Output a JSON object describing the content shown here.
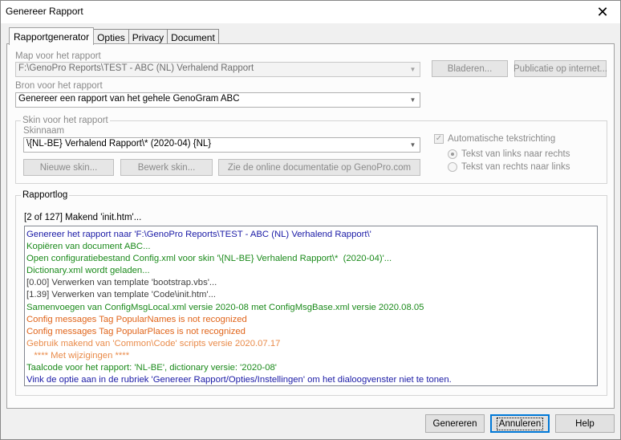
{
  "window": {
    "title": "Genereer Rapport",
    "close_symbol": "✕"
  },
  "tabs": [
    {
      "label": "Rapportgenerator",
      "active": true
    },
    {
      "label": "Opties",
      "active": false
    },
    {
      "label": "Privacy",
      "active": false
    },
    {
      "label": "Document",
      "active": false
    }
  ],
  "map": {
    "label": "Map voor het rapport",
    "value": "F:\\GenoPro Reports\\TEST - ABC (NL) Verhalend Rapport",
    "browse_label": "Bladeren...",
    "publish_label": "Publicatie op internet..."
  },
  "source": {
    "label": "Bron voor het rapport",
    "value": "Genereer een rapport van het gehele GenoGram ABC"
  },
  "skin": {
    "group_label": "Skin voor het rapport",
    "name_label": "Skinnaam",
    "value": "\\{NL-BE} Verhalend Rapport\\*  (2020-04)  {NL}",
    "new_label": "Nieuwe skin...",
    "edit_label": "Bewerk skin...",
    "docs_label": "Zie de online documentatie op GenoPro.com",
    "auto_direction_label": "Automatische tekstrichting",
    "auto_direction_checked": true,
    "ltr_label": "Tekst van links naar rechts",
    "rtl_label": "Tekst van rechts naar links",
    "ltr_selected": true
  },
  "log": {
    "group_label": "Rapportlog",
    "status": "[2 of 127] Makend 'init.htm'...",
    "lines": [
      {
        "text": "Genereer het rapport naar 'F:\\GenoPro Reports\\TEST - ABC (NL) Verhalend Rapport\\'",
        "color": "#1a1aa6"
      },
      {
        "text": "Kopiëren van document ABC...",
        "color": "#1b8a1b"
      },
      {
        "text": "Open configuratiebestand Config.xml voor skin '\\{NL-BE} Verhalend Rapport\\*  (2020-04)'...",
        "color": "#1b8a1b"
      },
      {
        "text": "Dictionary.xml wordt geladen...",
        "color": "#1b8a1b"
      },
      {
        "text": "[0.00] Verwerken van template 'bootstrap.vbs'...",
        "color": "#404040"
      },
      {
        "text": "[1.39] Verwerken van template 'Code\\init.htm'...",
        "color": "#404040"
      },
      {
        "text": "Samenvoegen van ConfigMsgLocal.xml versie 2020-08 met ConfigMsgBase.xml versie 2020.08.05",
        "color": "#1b8a1b"
      },
      {
        "text": "Config messages Tag PopularNames is not recognized",
        "color": "#e0641a"
      },
      {
        "text": "Config messages Tag PopularPlaces is not recognized",
        "color": "#e0641a"
      },
      {
        "text": "Gebruik makend van 'Common\\Code' scripts versie 2020.07.17",
        "color": "#e98b4a"
      },
      {
        "text": "   **** Met wijzigingen ****",
        "color": "#e98b4a"
      },
      {
        "text": "Taalcode voor het rapport: 'NL-BE', dictionary versie: '2020-08'",
        "color": "#1b8a1b"
      },
      {
        "text": "Vink de optie aan in de rubriek 'Genereer Rapport/Opties/Instellingen' om het dialoogvenster niet te tonen.",
        "color": "#1a1aa6"
      }
    ]
  },
  "buttons": {
    "generate": "Genereren",
    "cancel": "Annuleren",
    "help": "Help"
  }
}
